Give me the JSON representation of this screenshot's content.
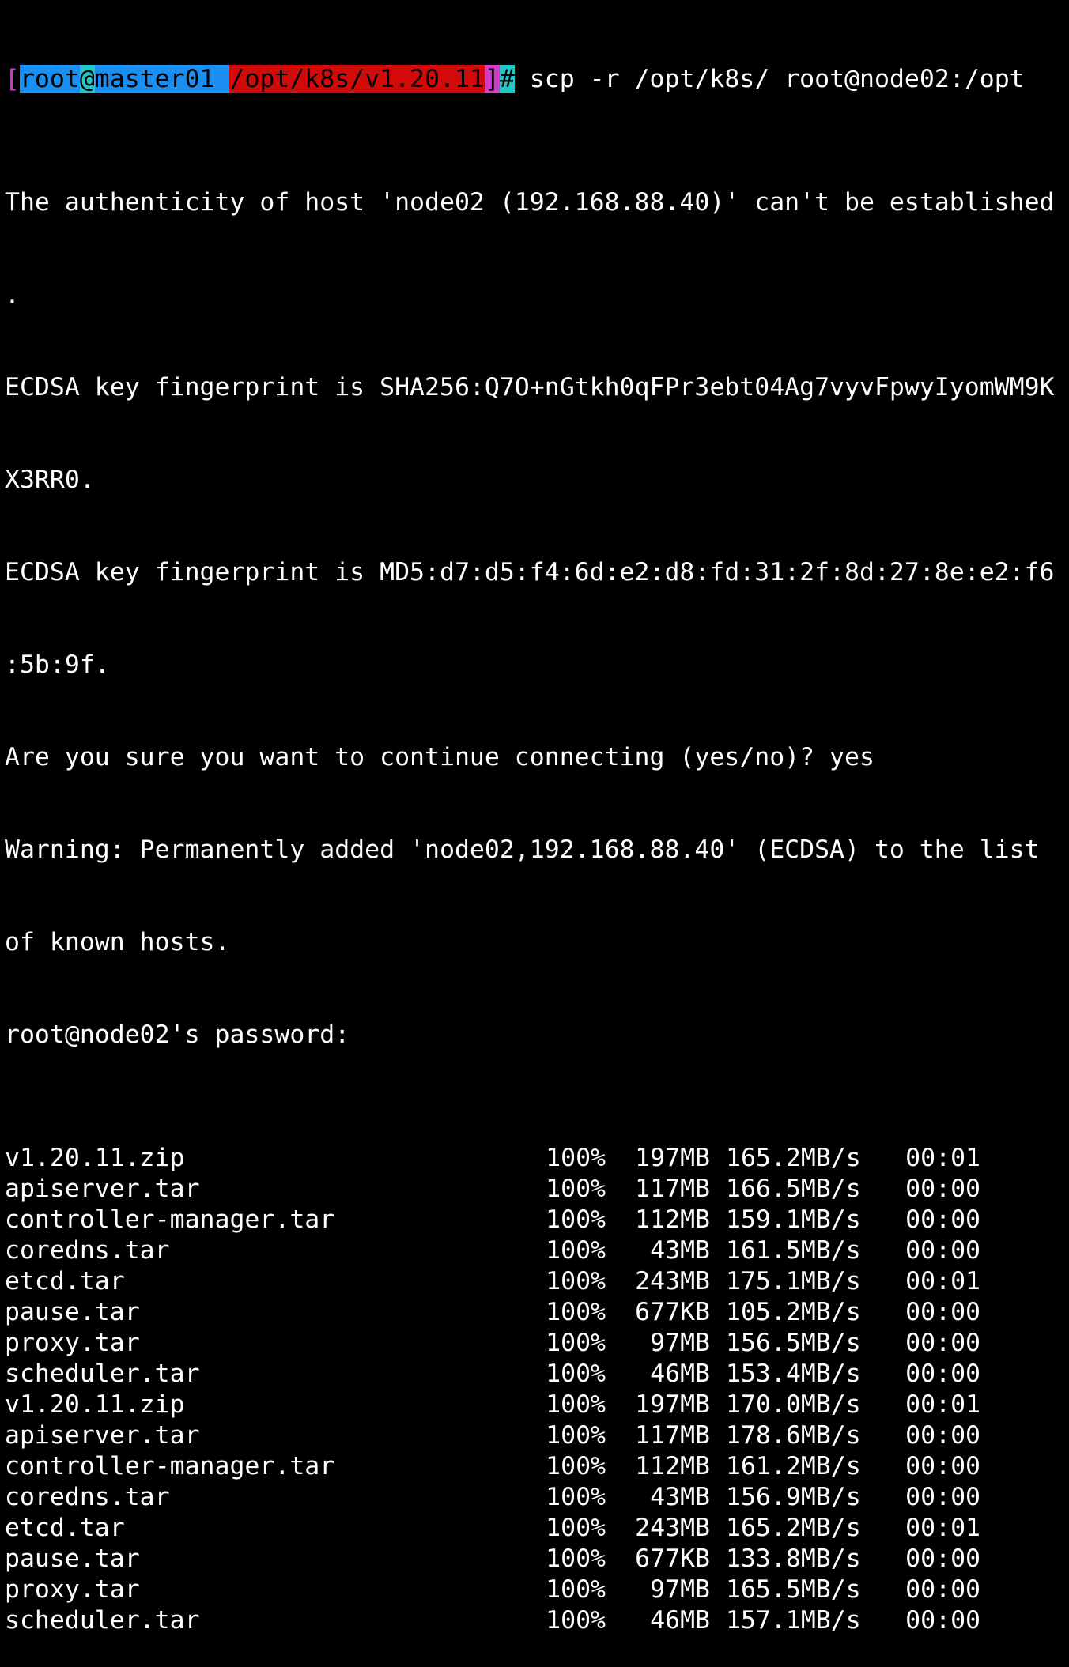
{
  "prompt": {
    "open_bracket": "[",
    "user": "root",
    "at": "@",
    "host": "master01 ",
    "path": "/opt/k8s/v1.20.11",
    "close_bracket": "]",
    "hash": "#",
    "command": " scp -r /opt/k8s/ root@node02:/opt"
  },
  "messages": [
    "The authenticity of host 'node02 (192.168.88.40)' can't be established",
    ".",
    "ECDSA key fingerprint is SHA256:Q7O+nGtkh0qFPr3ebt04Ag7vyvFpwyIyomWM9K",
    "X3RR0.",
    "ECDSA key fingerprint is MD5:d7:d5:f4:6d:e2:d8:fd:31:2f:8d:27:8e:e2:f6",
    ":5b:9f.",
    "Are you sure you want to continue connecting (yes/no)? yes",
    "Warning: Permanently added 'node02,192.168.88.40' (ECDSA) to the list",
    "of known hosts.",
    "root@node02's password:"
  ],
  "transfers": [
    {
      "file": "v1.20.11.zip",
      "percent": "100%",
      "size": "197MB",
      "rate": "165.2MB/s",
      "time": "00:01"
    },
    {
      "file": "apiserver.tar",
      "percent": "100%",
      "size": "117MB",
      "rate": "166.5MB/s",
      "time": "00:00"
    },
    {
      "file": "controller-manager.tar",
      "percent": "100%",
      "size": "112MB",
      "rate": "159.1MB/s",
      "time": "00:00"
    },
    {
      "file": "coredns.tar",
      "percent": "100%",
      "size": "43MB",
      "rate": "161.5MB/s",
      "time": "00:00"
    },
    {
      "file": "etcd.tar",
      "percent": "100%",
      "size": "243MB",
      "rate": "175.1MB/s",
      "time": "00:01"
    },
    {
      "file": "pause.tar",
      "percent": "100%",
      "size": "677KB",
      "rate": "105.2MB/s",
      "time": "00:00"
    },
    {
      "file": "proxy.tar",
      "percent": "100%",
      "size": "97MB",
      "rate": "156.5MB/s",
      "time": "00:00"
    },
    {
      "file": "scheduler.tar",
      "percent": "100%",
      "size": "46MB",
      "rate": "153.4MB/s",
      "time": "00:00"
    },
    {
      "file": "v1.20.11.zip",
      "percent": "100%",
      "size": "197MB",
      "rate": "170.0MB/s",
      "time": "00:01"
    },
    {
      "file": "apiserver.tar",
      "percent": "100%",
      "size": "117MB",
      "rate": "178.6MB/s",
      "time": "00:00"
    },
    {
      "file": "controller-manager.tar",
      "percent": "100%",
      "size": "112MB",
      "rate": "161.2MB/s",
      "time": "00:00"
    },
    {
      "file": "coredns.tar",
      "percent": "100%",
      "size": "43MB",
      "rate": "156.9MB/s",
      "time": "00:00"
    },
    {
      "file": "etcd.tar",
      "percent": "100%",
      "size": "243MB",
      "rate": "165.2MB/s",
      "time": "00:01"
    },
    {
      "file": "pause.tar",
      "percent": "100%",
      "size": "677KB",
      "rate": "133.8MB/s",
      "time": "00:00"
    },
    {
      "file": "proxy.tar",
      "percent": "100%",
      "size": "97MB",
      "rate": "165.5MB/s",
      "time": "00:00"
    },
    {
      "file": "scheduler.tar",
      "percent": "100%",
      "size": "46MB",
      "rate": "157.1MB/s",
      "time": "00:00"
    }
  ],
  "colors": {
    "background": "#000000",
    "foreground": "#ffffff",
    "prompt_bracket": "#d33ac8",
    "prompt_user_bg": "#1b8ef2",
    "prompt_at_bg": "#24c6c6",
    "prompt_path_bg": "#d10a0a"
  }
}
